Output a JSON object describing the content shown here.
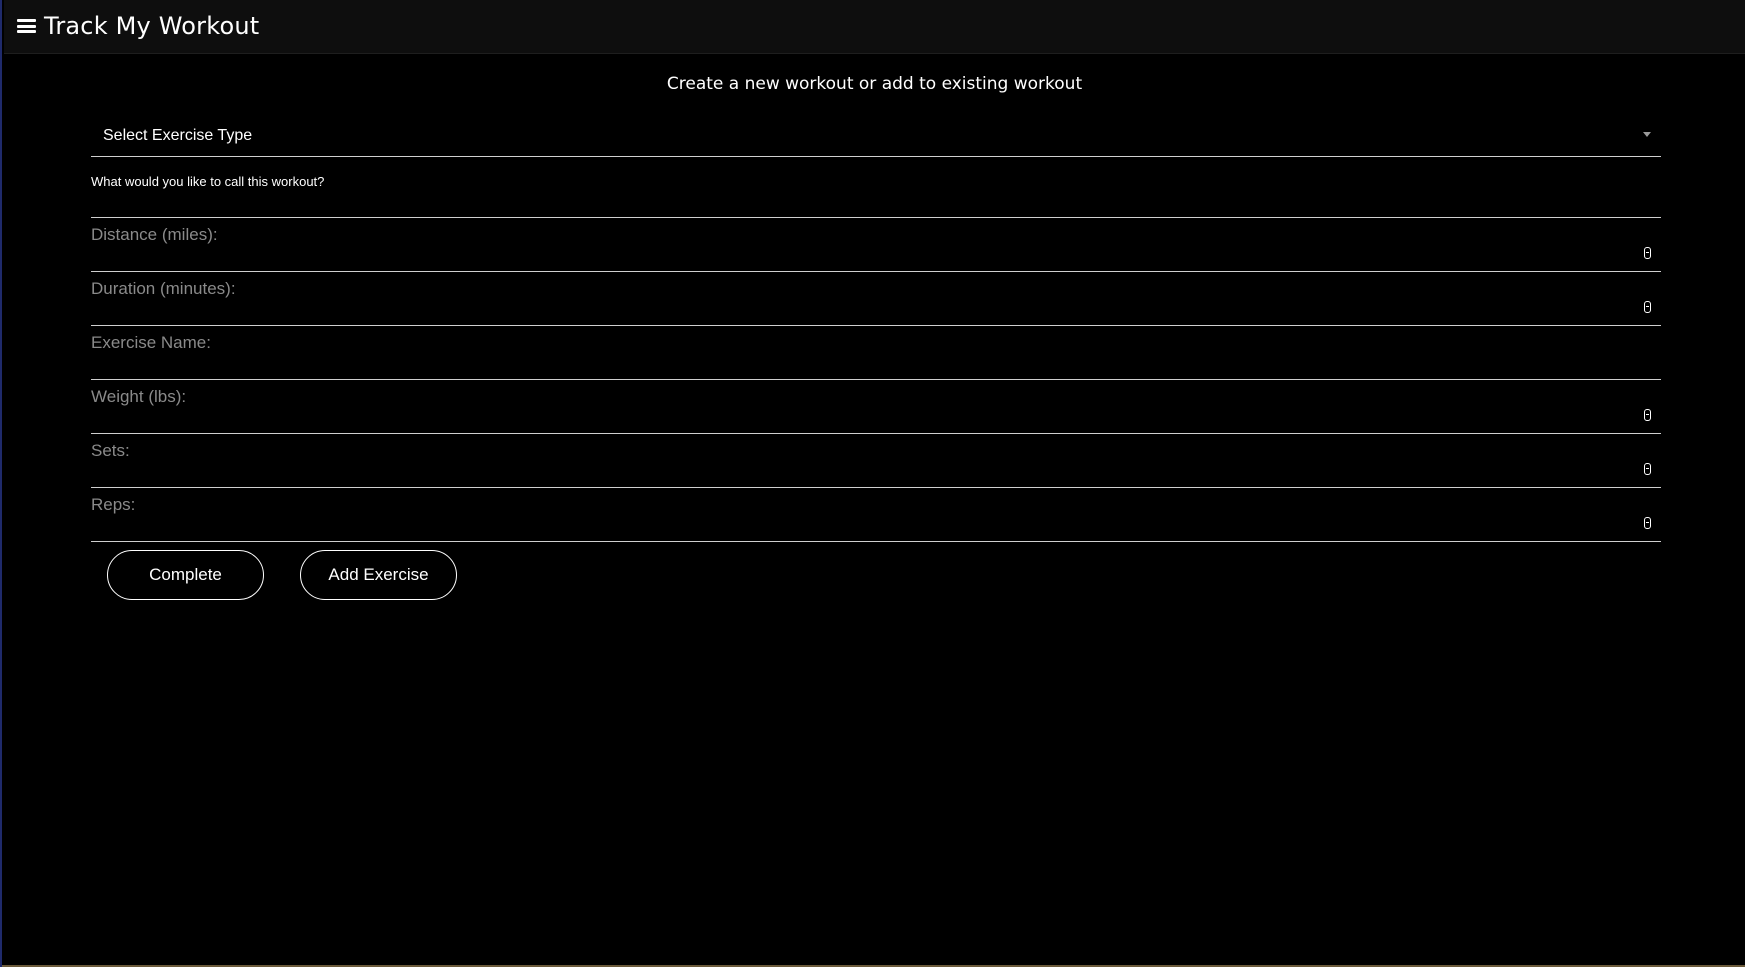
{
  "app": {
    "title": "Track My Workout"
  },
  "main": {
    "subtitle": "Create a new workout or add to existing workout"
  },
  "form": {
    "exercise_type": {
      "selected": "Select Exercise Type"
    },
    "workout_name": {
      "label": "What would you like to call this workout?",
      "value": ""
    },
    "fields": [
      {
        "placeholder": "Distance (miles):",
        "type": "number",
        "value": ""
      },
      {
        "placeholder": "Duration (minutes):",
        "type": "number",
        "value": ""
      },
      {
        "placeholder": "Exercise Name:",
        "type": "text",
        "value": ""
      },
      {
        "placeholder": "Weight (lbs):",
        "type": "number",
        "value": ""
      },
      {
        "placeholder": "Sets:",
        "type": "number",
        "value": ""
      },
      {
        "placeholder": "Reps:",
        "type": "number",
        "value": ""
      }
    ],
    "buttons": {
      "complete": "Complete",
      "add_exercise": "Add Exercise"
    }
  },
  "icons": {
    "menu": "hamburger-menu-icon",
    "dropdown": "caret-down-icon",
    "spinner": "number-spinner-icon"
  },
  "colors": {
    "background": "#000000",
    "header": "#0e0e0e",
    "text": "#ffffff",
    "placeholder": "#8a8a8a",
    "underline": "#cfcfcf"
  }
}
